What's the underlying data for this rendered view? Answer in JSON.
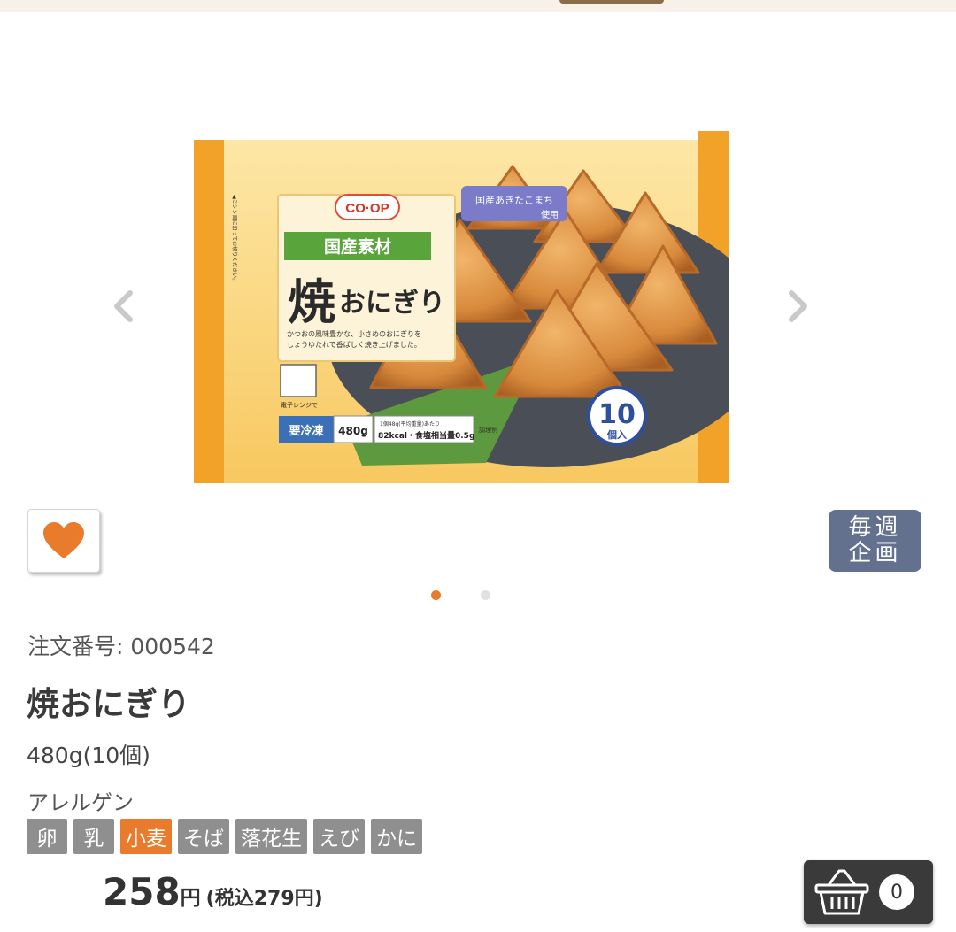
{
  "package": {
    "brand": "CO·OP",
    "tag": "国産素材",
    "rice_note": "国産あきたこまち",
    "rice_note2": "使用",
    "product_name_kanji": "焼",
    "product_name_kana": "おにぎり",
    "description_1": "かつおの風味豊かな、小さめのおにぎりを",
    "description_2": "しょうゆたれで香ばしく焼き上げました。",
    "microwave_label": "電子レンジで",
    "frozen_label": "要冷凍",
    "weight_label": "480g",
    "nutrition_note": "1個48g(平均重量)あたり",
    "kcal": "82kcal・食塩相当量0.5g",
    "count_number": "10",
    "count_unit": "個入",
    "side_note": "◀ミシン目に沿ってお切りください。",
    "seasoning_note": "調理例"
  },
  "badge_weekly": {
    "line1": "毎週",
    "line2": "企画"
  },
  "product": {
    "order_number": "注文番号: 000542",
    "name": "焼おにぎり",
    "quantity": "480g(10個)",
    "allergen_label": "アレルゲン",
    "allergens": [
      {
        "name": "卵",
        "active": false
      },
      {
        "name": "乳",
        "active": false
      },
      {
        "name": "小麦",
        "active": true
      },
      {
        "name": "そば",
        "active": false
      },
      {
        "name": "落花生",
        "active": false
      },
      {
        "name": "えび",
        "active": false
      },
      {
        "name": "かに",
        "active": false
      }
    ],
    "price": "258",
    "price_unit": "円",
    "price_tax": "(税込279円)"
  },
  "carousel": {
    "total_slides": 2,
    "active_slide": 1
  },
  "cart": {
    "count": "0"
  },
  "colors": {
    "accent": "#e97b2c",
    "inactive": "#8f8f8f",
    "badge": "#63718f",
    "cart_bg": "#3a3a3a"
  }
}
